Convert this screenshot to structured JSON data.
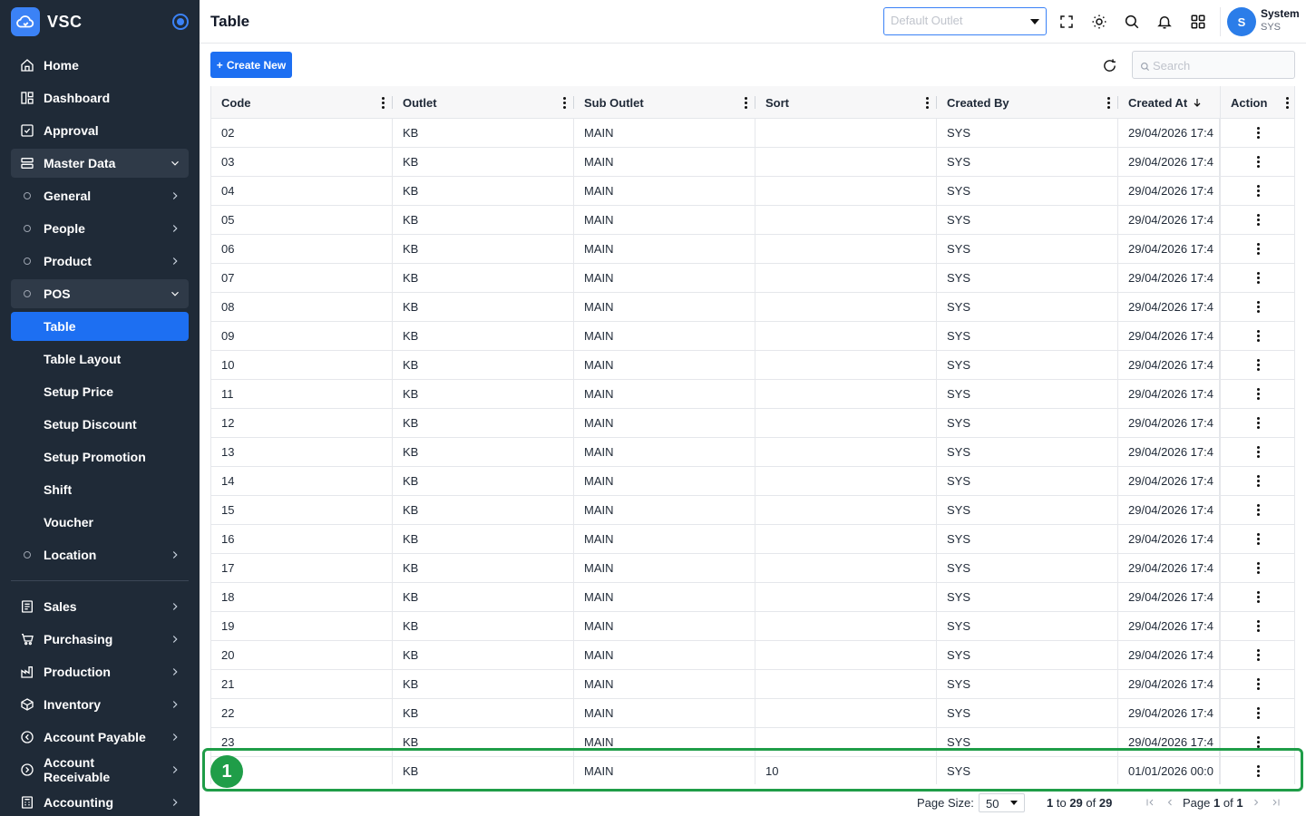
{
  "app": {
    "name": "VSC"
  },
  "sidebar": {
    "items": [
      {
        "label": "Home",
        "icon": "home-icon"
      },
      {
        "label": "Dashboard",
        "icon": "dashboard-icon"
      },
      {
        "label": "Approval",
        "icon": "approval-icon"
      },
      {
        "label": "Master Data",
        "icon": "server-icon"
      },
      {
        "label": "General"
      },
      {
        "label": "People"
      },
      {
        "label": "Product"
      },
      {
        "label": "POS"
      },
      {
        "label": "Table"
      },
      {
        "label": "Table Layout"
      },
      {
        "label": "Setup Price"
      },
      {
        "label": "Setup Discount"
      },
      {
        "label": "Setup Promotion"
      },
      {
        "label": "Shift"
      },
      {
        "label": "Voucher"
      },
      {
        "label": "Location"
      },
      {
        "label": "Sales",
        "icon": "sales-icon"
      },
      {
        "label": "Purchasing",
        "icon": "cart-icon"
      },
      {
        "label": "Production",
        "icon": "factory-icon"
      },
      {
        "label": "Inventory",
        "icon": "box-icon"
      },
      {
        "label": "Account Payable",
        "icon": "payable-icon"
      },
      {
        "label": "Account Receivable",
        "icon": "receivable-icon"
      },
      {
        "label": "Accounting",
        "icon": "calculator-icon"
      }
    ]
  },
  "header": {
    "title": "Table",
    "outlet_placeholder": "Default Outlet",
    "user_name": "System",
    "user_code": "SYS",
    "avatar_initial": "S"
  },
  "toolbar": {
    "create_label": "Create New",
    "search_placeholder": "Search"
  },
  "table": {
    "columns": [
      "Code",
      "Outlet",
      "Sub Outlet",
      "Sort",
      "Created By",
      "Created At",
      "Action"
    ],
    "rows": [
      [
        "02",
        "KB",
        "MAIN",
        "",
        "SYS",
        "29/04/2026 17:4"
      ],
      [
        "03",
        "KB",
        "MAIN",
        "",
        "SYS",
        "29/04/2026 17:4"
      ],
      [
        "04",
        "KB",
        "MAIN",
        "",
        "SYS",
        "29/04/2026 17:4"
      ],
      [
        "05",
        "KB",
        "MAIN",
        "",
        "SYS",
        "29/04/2026 17:4"
      ],
      [
        "06",
        "KB",
        "MAIN",
        "",
        "SYS",
        "29/04/2026 17:4"
      ],
      [
        "07",
        "KB",
        "MAIN",
        "",
        "SYS",
        "29/04/2026 17:4"
      ],
      [
        "08",
        "KB",
        "MAIN",
        "",
        "SYS",
        "29/04/2026 17:4"
      ],
      [
        "09",
        "KB",
        "MAIN",
        "",
        "SYS",
        "29/04/2026 17:4"
      ],
      [
        "10",
        "KB",
        "MAIN",
        "",
        "SYS",
        "29/04/2026 17:4"
      ],
      [
        "11",
        "KB",
        "MAIN",
        "",
        "SYS",
        "29/04/2026 17:4"
      ],
      [
        "12",
        "KB",
        "MAIN",
        "",
        "SYS",
        "29/04/2026 17:4"
      ],
      [
        "13",
        "KB",
        "MAIN",
        "",
        "SYS",
        "29/04/2026 17:4"
      ],
      [
        "14",
        "KB",
        "MAIN",
        "",
        "SYS",
        "29/04/2026 17:4"
      ],
      [
        "15",
        "KB",
        "MAIN",
        "",
        "SYS",
        "29/04/2026 17:4"
      ],
      [
        "16",
        "KB",
        "MAIN",
        "",
        "SYS",
        "29/04/2026 17:4"
      ],
      [
        "17",
        "KB",
        "MAIN",
        "",
        "SYS",
        "29/04/2026 17:4"
      ],
      [
        "18",
        "KB",
        "MAIN",
        "",
        "SYS",
        "29/04/2026 17:4"
      ],
      [
        "19",
        "KB",
        "MAIN",
        "",
        "SYS",
        "29/04/2026 17:4"
      ],
      [
        "20",
        "KB",
        "MAIN",
        "",
        "SYS",
        "29/04/2026 17:4"
      ],
      [
        "21",
        "KB",
        "MAIN",
        "",
        "SYS",
        "29/04/2026 17:4"
      ],
      [
        "22",
        "KB",
        "MAIN",
        "",
        "SYS",
        "29/04/2026 17:4"
      ],
      [
        "23",
        "KB",
        "MAIN",
        "",
        "SYS",
        "29/04/2026 17:4"
      ],
      [
        "",
        "KB",
        "MAIN",
        "10",
        "SYS",
        "01/01/2026 00:0"
      ]
    ]
  },
  "highlight": {
    "badge": "1"
  },
  "pagination": {
    "page_size_label": "Page Size:",
    "page_size": "50",
    "range_start": "1",
    "range_to": "to",
    "range_end": "29",
    "range_of": "of",
    "range_total": "29",
    "page_word": "Page",
    "page_current": "1",
    "page_of": "of",
    "page_total": "1"
  },
  "colors": {
    "sidebar_bg": "#1f2a37",
    "accent": "#1d6ff2",
    "highlight": "#1f9d48"
  }
}
